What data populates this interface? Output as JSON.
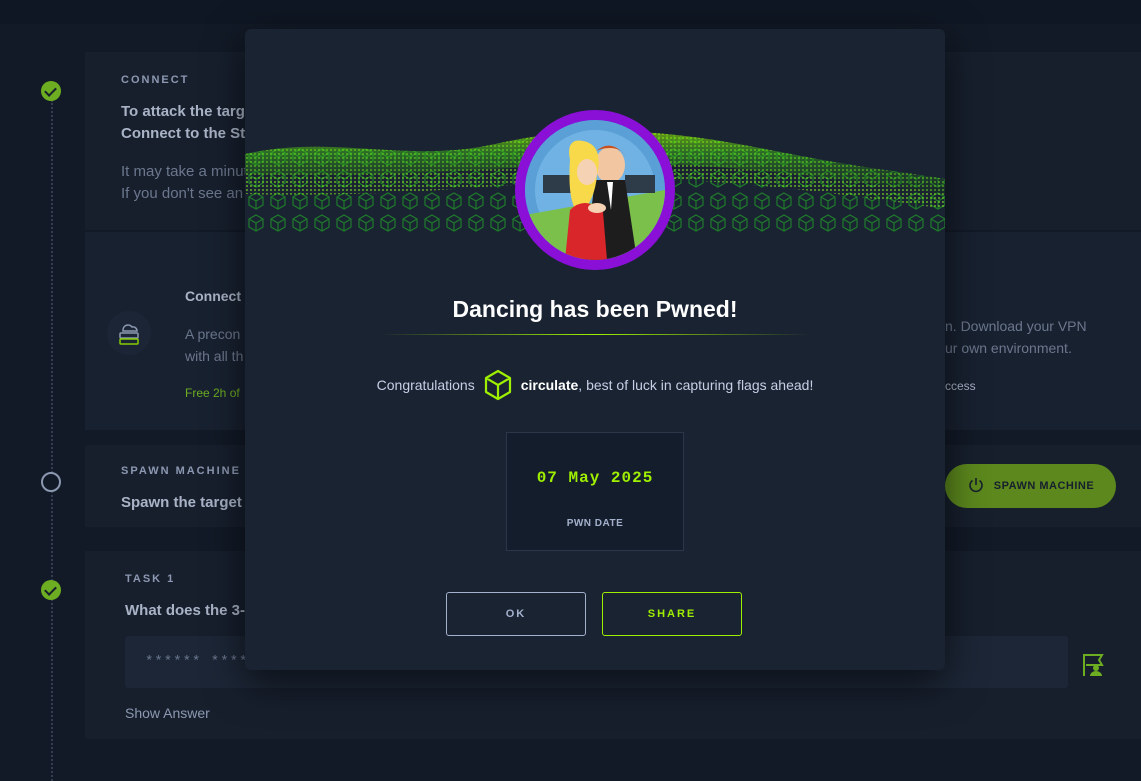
{
  "background": {
    "connect_card": {
      "label": "CONNECT",
      "line1": "To attack the targe",
      "line2": "Connect to the Sta",
      "line3": "It may take a minut",
      "line4": "If you don't see an"
    },
    "vpn_card": {
      "title": "Connect",
      "desc1": "A precon",
      "desc2": "with all th",
      "free": "Free 2h of",
      "right1": "n. Download your VPN",
      "right2": "ur own environment.",
      "right3": "ccess"
    },
    "spawn_card": {
      "label": "SPAWN MACHINE",
      "line": "Spawn the target r",
      "button": "SPAWN MACHINE"
    },
    "task_card": {
      "label": "TASK 1",
      "question": "What does the 3-l",
      "answer_mask": "****** ****",
      "show_answer": "Show Answer"
    }
  },
  "modal": {
    "title": "Dancing has been Pwned!",
    "congrats_prefix": "Congratulations",
    "username": "circulate",
    "congrats_suffix": ", best of luck in capturing flags ahead!",
    "pwn_date": "07 May 2025",
    "pwn_date_label": "PWN DATE",
    "ok_label": "OK",
    "share_label": "SHARE"
  },
  "colors": {
    "accent_green": "#9fef00",
    "avatar_ring": "#8a10d8",
    "background": "#141d2b",
    "card": "#1a2332"
  },
  "icons": [
    "check-icon",
    "cloud-server-icon",
    "power-icon",
    "cube-icon",
    "flag-user-icon"
  ]
}
